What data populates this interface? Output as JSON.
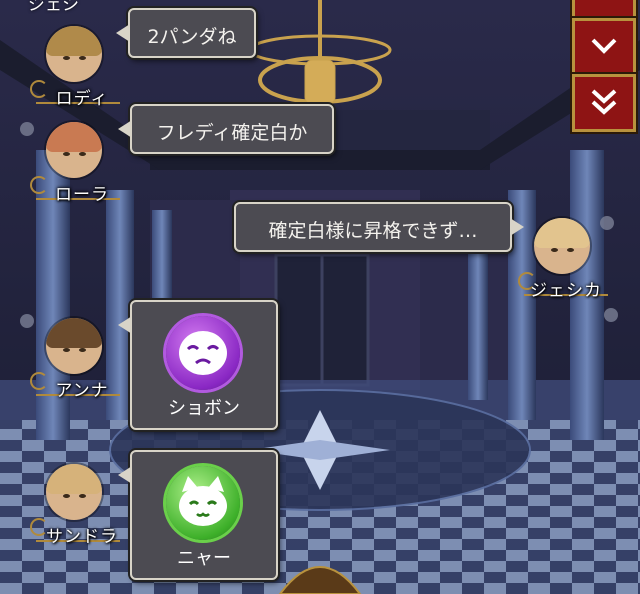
{
  "players": [
    {
      "name": "ロディ",
      "message": "2パンダね"
    },
    {
      "name": "ローラ",
      "message": "フレディ確定白か"
    },
    {
      "name": "ジェシカ",
      "message": "確定白様に昇格できず…"
    },
    {
      "name": "アンナ",
      "stamp_label": "ショボン"
    },
    {
      "name": "サンドラ",
      "stamp_label": "ニャー"
    }
  ],
  "top_partial_name": "ジェシ",
  "colors": {
    "bubble_bg": "#4c4b52",
    "bubble_border": "#d8d4c8",
    "button_red": "#8e1414",
    "gold": "#b8923e"
  }
}
